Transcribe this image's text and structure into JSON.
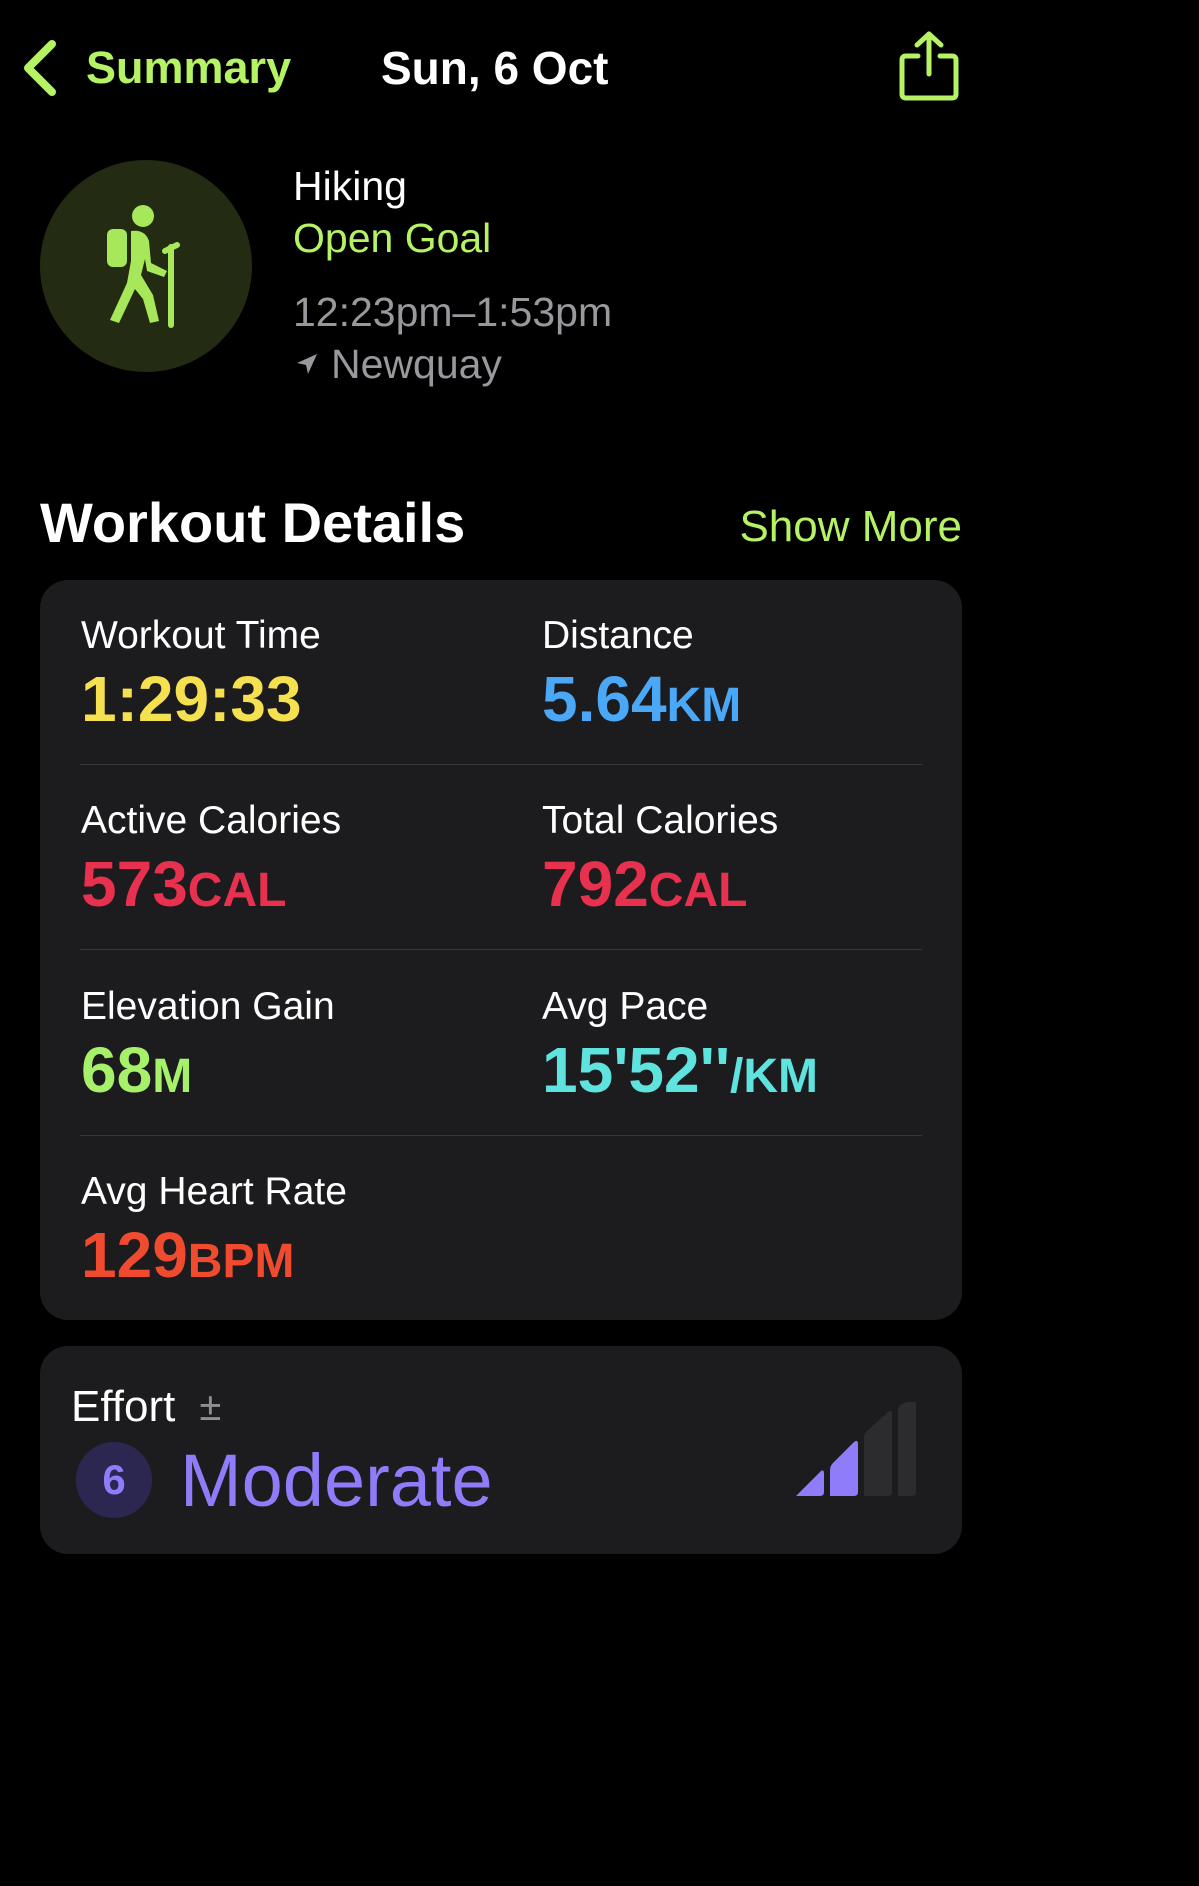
{
  "nav": {
    "back_label": "Summary",
    "title": "Sun, 6 Oct"
  },
  "workout": {
    "activity": "Hiking",
    "goal": "Open Goal",
    "time_range": "12:23pm–1:53pm",
    "location": "Newquay"
  },
  "details": {
    "title": "Workout Details",
    "show_more": "Show More",
    "metrics": [
      {
        "label": "Workout Time",
        "value": "1:29:33",
        "unit": "",
        "color": "#f5e04f"
      },
      {
        "label": "Distance",
        "value": "5.64",
        "unit": "KM",
        "color": "#4aa8f7"
      },
      {
        "label": "Active Calories",
        "value": "573",
        "unit": "CAL",
        "color": "#e8314f"
      },
      {
        "label": "Total Calories",
        "value": "792",
        "unit": "CAL",
        "color": "#e8314f"
      },
      {
        "label": "Elevation Gain",
        "value": "68",
        "unit": "M",
        "color": "#a7f16a"
      },
      {
        "label": "Avg Pace",
        "value": "15'52''",
        "unit": "/KM",
        "color": "#5fe3df"
      },
      {
        "label": "Avg Heart Rate",
        "value": "129",
        "unit": "BPM",
        "color": "#f04a2f"
      }
    ]
  },
  "effort": {
    "label": "Effort",
    "adjust_symbol": "±",
    "score": "6",
    "level": "Moderate",
    "bars_filled": 2,
    "bars_total": 4
  },
  "colors": {
    "accent": "#b5f264",
    "effort": "#8e7cf8",
    "card": "#1c1c1e"
  },
  "icons": {
    "back": "chevron-left-icon",
    "share": "share-icon",
    "activity": "hiking-figure-icon",
    "location": "location-arrow-icon",
    "effort": "effort-bars-icon"
  }
}
